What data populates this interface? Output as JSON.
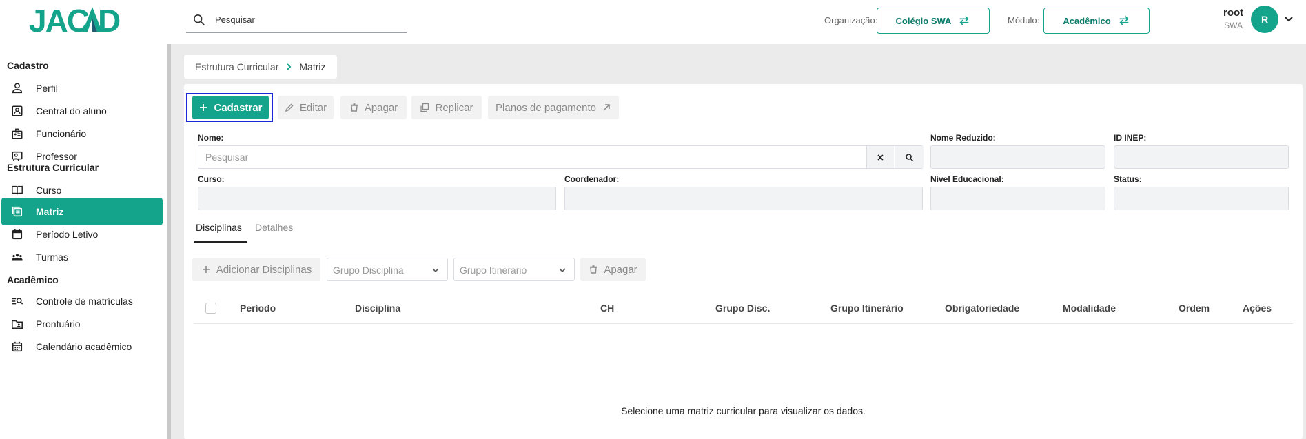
{
  "header": {
    "logo_text": "JACAD",
    "search_placeholder": "Pesquisar",
    "org_label": "Organização:",
    "org_value": "Colégio SWA",
    "module_label": "Módulo:",
    "module_value": "Acadêmico",
    "user_name": "root",
    "user_org": "SWA",
    "avatar_letter": "R",
    "accent": "#14a38b"
  },
  "sidebar": {
    "sections": [
      {
        "title": "Cadastro",
        "items": [
          {
            "label": "Perfil",
            "icon": "person-icon"
          },
          {
            "label": "Central do aluno",
            "icon": "student-card-icon"
          },
          {
            "label": "Funcionário",
            "icon": "employee-badge-icon"
          },
          {
            "label": "Professor",
            "icon": "teacher-icon"
          }
        ]
      },
      {
        "title": "Estrutura Curricular",
        "items": [
          {
            "label": "Curso",
            "icon": "book-open-icon"
          },
          {
            "label": "Matriz",
            "icon": "matrix-icon",
            "active": true
          },
          {
            "label": "Período Letivo",
            "icon": "calendar-icon"
          },
          {
            "label": "Turmas",
            "icon": "group-icon"
          }
        ]
      },
      {
        "title": "Acadêmico",
        "items": [
          {
            "label": "Controle de matrículas",
            "icon": "search-list-icon"
          },
          {
            "label": "Prontuário",
            "icon": "folder-person-icon"
          },
          {
            "label": "Calendário acadêmico",
            "icon": "calendar-grid-icon"
          }
        ]
      }
    ]
  },
  "breadcrumb": {
    "parent": "Estrutura Curricular",
    "current": "Matriz"
  },
  "toolbar": {
    "cadastrar": "Cadastrar",
    "editar": "Editar",
    "apagar": "Apagar",
    "replicar": "Replicar",
    "planos": "Planos de pagamento"
  },
  "form": {
    "nome_label": "Nome:",
    "nome_placeholder": "Pesquisar",
    "nome_reduzido_label": "Nome Reduzido:",
    "id_inep_label": "ID INEP:",
    "curso_label": "Curso:",
    "coordenador_label": "Coordenador:",
    "nivel_label": "Nível Educacional:",
    "status_label": "Status:"
  },
  "tabs": {
    "disciplinas": "Disciplinas",
    "detalhes": "Detalhes"
  },
  "subtoolbar": {
    "adicionar": "Adicionar Disciplinas",
    "grupo_disciplina": "Grupo Disciplina",
    "grupo_itinerario": "Grupo Itinerário",
    "apagar": "Apagar"
  },
  "table": {
    "columns": [
      "Período",
      "Disciplina",
      "CH",
      "Grupo Disc.",
      "Grupo Itinerário",
      "Obrigatoriedade",
      "Modalidade",
      "Ordem",
      "Ações"
    ],
    "empty_message": "Selecione uma matriz curricular para visualizar os dados."
  }
}
